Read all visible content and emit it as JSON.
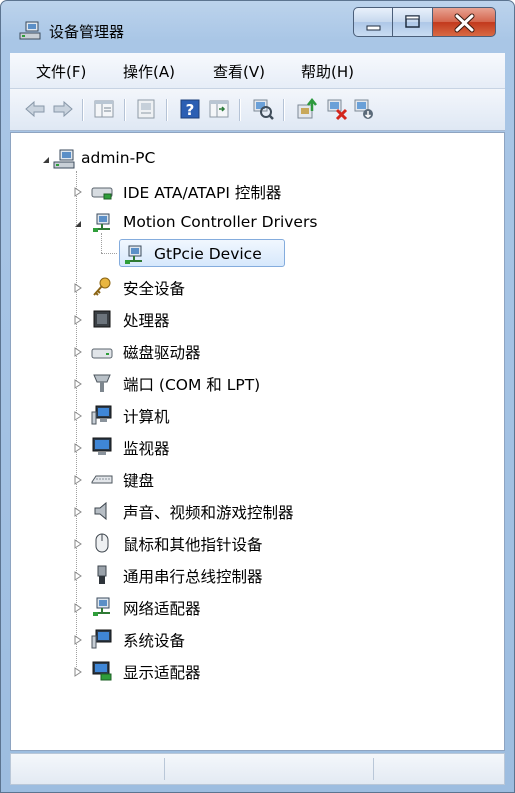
{
  "window": {
    "title": "设备管理器"
  },
  "title_buttons": {
    "minimize": "minimize-icon",
    "maximize": "maximize-icon",
    "close": "close-icon"
  },
  "menu": [
    {
      "label": "文件(F)"
    },
    {
      "label": "操作(A)"
    },
    {
      "label": "查看(V)"
    },
    {
      "label": "帮助(H)"
    }
  ],
  "toolbar": [
    "back-arrow-icon",
    "forward-arrow-icon",
    "show-hide-tree-icon",
    "properties-icon",
    "help-icon",
    "update-view-icon",
    "scan-hardware-icon",
    "update-driver-icon",
    "uninstall-icon",
    "disable-device-icon"
  ],
  "tree": {
    "root": {
      "label": "admin-PC",
      "icon": "computer-icon",
      "expanded": true
    },
    "items": [
      {
        "label": "IDE ATA/ATAPI 控制器",
        "icon": "ide-controller-icon",
        "expanded": false
      },
      {
        "label": "Motion Controller Drivers",
        "icon": "network-device-icon",
        "expanded": true,
        "children": [
          {
            "label": "GtPcie Device",
            "icon": "network-device-icon",
            "selected": true
          }
        ]
      },
      {
        "label": "安全设备",
        "icon": "security-key-icon",
        "expanded": false
      },
      {
        "label": "处理器",
        "icon": "processor-icon",
        "expanded": false
      },
      {
        "label": "磁盘驱动器",
        "icon": "disk-drive-icon",
        "expanded": false
      },
      {
        "label": "端口 (COM 和 LPT)",
        "icon": "port-icon",
        "expanded": false
      },
      {
        "label": "计算机",
        "icon": "computer-monitor-icon",
        "expanded": false
      },
      {
        "label": "监视器",
        "icon": "monitor-icon",
        "expanded": false
      },
      {
        "label": "键盘",
        "icon": "keyboard-icon",
        "expanded": false
      },
      {
        "label": "声音、视频和游戏控制器",
        "icon": "speaker-icon",
        "expanded": false
      },
      {
        "label": "鼠标和其他指针设备",
        "icon": "mouse-icon",
        "expanded": false
      },
      {
        "label": "通用串行总线控制器",
        "icon": "usb-icon",
        "expanded": false
      },
      {
        "label": "网络适配器",
        "icon": "network-adapter-icon",
        "expanded": false
      },
      {
        "label": "系统设备",
        "icon": "system-device-icon",
        "expanded": false
      },
      {
        "label": "显示适配器",
        "icon": "display-adapter-icon",
        "expanded": false
      }
    ]
  },
  "colors": {
    "selection_border": "#84acdd",
    "selection_fill": "#d6e8fc",
    "close_button": "#c2391c"
  }
}
